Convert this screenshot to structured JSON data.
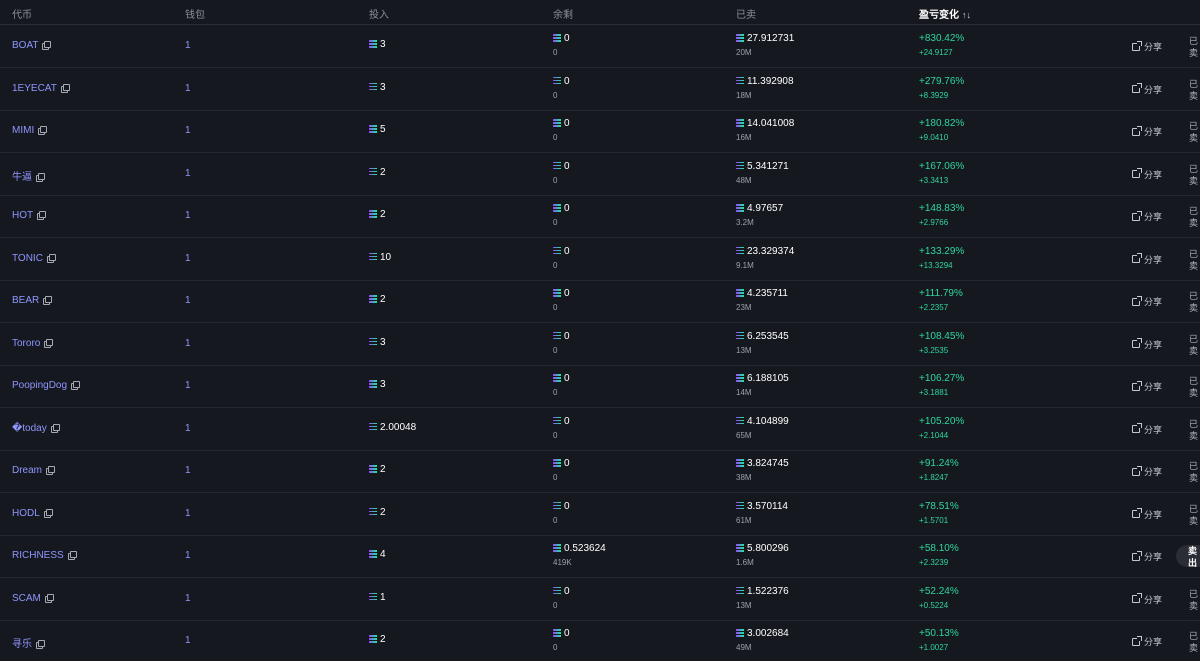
{
  "header": {
    "token": "代币",
    "wallet": "钱包",
    "invest": "投入",
    "remaining": "余剩",
    "sold": "已卖",
    "pnl": "盈亏变化",
    "sort_icon": "sort-arrows-icon"
  },
  "rows": [
    {
      "token": "BOAT",
      "wallet": "1",
      "invest": "3",
      "remain": "0",
      "remain_sub": "0",
      "sold": "27.912731",
      "sold_sub": "20M",
      "pnl_pct": "+830.42%",
      "pnl_val": "+24.9127",
      "share": "分享",
      "status": "已卖"
    },
    {
      "token": "1EYECAT",
      "wallet": "1",
      "invest": "3",
      "remain": "0",
      "remain_sub": "0",
      "sold": "11.392908",
      "sold_sub": "18M",
      "pnl_pct": "+279.76%",
      "pnl_val": "+8.3929",
      "share": "分享",
      "status": "已卖"
    },
    {
      "token": "MIMI",
      "wallet": "1",
      "invest": "5",
      "remain": "0",
      "remain_sub": "0",
      "sold": "14.041008",
      "sold_sub": "16M",
      "pnl_pct": "+180.82%",
      "pnl_val": "+9.0410",
      "share": "分享",
      "status": "已卖"
    },
    {
      "token": "牛逼",
      "wallet": "1",
      "invest": "2",
      "remain": "0",
      "remain_sub": "0",
      "sold": "5.341271",
      "sold_sub": "48M",
      "pnl_pct": "+167.06%",
      "pnl_val": "+3.3413",
      "share": "分享",
      "status": "已卖"
    },
    {
      "token": "HOT",
      "wallet": "1",
      "invest": "2",
      "remain": "0",
      "remain_sub": "0",
      "sold": "4.97657",
      "sold_sub": "3.2M",
      "pnl_pct": "+148.83%",
      "pnl_val": "+2.9766",
      "share": "分享",
      "status": "已卖"
    },
    {
      "token": "TONIC",
      "wallet": "1",
      "invest": "10",
      "remain": "0",
      "remain_sub": "0",
      "sold": "23.329374",
      "sold_sub": "9.1M",
      "pnl_pct": "+133.29%",
      "pnl_val": "+13.3294",
      "share": "分享",
      "status": "已卖"
    },
    {
      "token": "BEAR",
      "wallet": "1",
      "invest": "2",
      "remain": "0",
      "remain_sub": "0",
      "sold": "4.235711",
      "sold_sub": "23M",
      "pnl_pct": "+111.79%",
      "pnl_val": "+2.2357",
      "share": "分享",
      "status": "已卖"
    },
    {
      "token": "Tororo",
      "wallet": "1",
      "invest": "3",
      "remain": "0",
      "remain_sub": "0",
      "sold": "6.253545",
      "sold_sub": "13M",
      "pnl_pct": "+108.45%",
      "pnl_val": "+3.2535",
      "share": "分享",
      "status": "已卖"
    },
    {
      "token": "PoopingDog",
      "wallet": "1",
      "invest": "3",
      "remain": "0",
      "remain_sub": "0",
      "sold": "6.188105",
      "sold_sub": "14M",
      "pnl_pct": "+106.27%",
      "pnl_val": "+3.1881",
      "share": "分享",
      "status": "已卖"
    },
    {
      "token": "�today",
      "wallet": "1",
      "invest": "2.00048",
      "remain": "0",
      "remain_sub": "0",
      "sold": "4.104899",
      "sold_sub": "65M",
      "pnl_pct": "+105.20%",
      "pnl_val": "+2.1044",
      "share": "分享",
      "status": "已卖"
    },
    {
      "token": "Dream",
      "wallet": "1",
      "invest": "2",
      "remain": "0",
      "remain_sub": "0",
      "sold": "3.824745",
      "sold_sub": "38M",
      "pnl_pct": "+91.24%",
      "pnl_val": "+1.8247",
      "share": "分享",
      "status": "已卖"
    },
    {
      "token": "HODL",
      "wallet": "1",
      "invest": "2",
      "remain": "0",
      "remain_sub": "0",
      "sold": "3.570114",
      "sold_sub": "61M",
      "pnl_pct": "+78.51%",
      "pnl_val": "+1.5701",
      "share": "分享",
      "status": "已卖"
    },
    {
      "token": "RICHNESS",
      "wallet": "1",
      "invest": "4",
      "remain": "0.523624",
      "remain_sub": "419K",
      "sold": "5.800296",
      "sold_sub": "1.6M",
      "pnl_pct": "+58.10%",
      "pnl_val": "+2.3239",
      "share": "分享",
      "status": "卖出"
    },
    {
      "token": "SCAM",
      "wallet": "1",
      "invest": "1",
      "remain": "0",
      "remain_sub": "0",
      "sold": "1.522376",
      "sold_sub": "13M",
      "pnl_pct": "+52.24%",
      "pnl_val": "+0.5224",
      "share": "分享",
      "status": "已卖"
    },
    {
      "token": "寻乐",
      "wallet": "1",
      "invest": "2",
      "remain": "0",
      "remain_sub": "0",
      "sold": "3.002684",
      "sold_sub": "49M",
      "pnl_pct": "+50.13%",
      "pnl_val": "+1.0027",
      "share": "分享",
      "status": "已卖"
    }
  ],
  "colors": {
    "background": "#16181f",
    "link": "#8e96ff",
    "positive": "#2fd6a0",
    "muted": "#9aa0ac"
  },
  "icons": {
    "copy": "copy-icon",
    "currency": "solana-icon",
    "share": "external-link-icon"
  }
}
